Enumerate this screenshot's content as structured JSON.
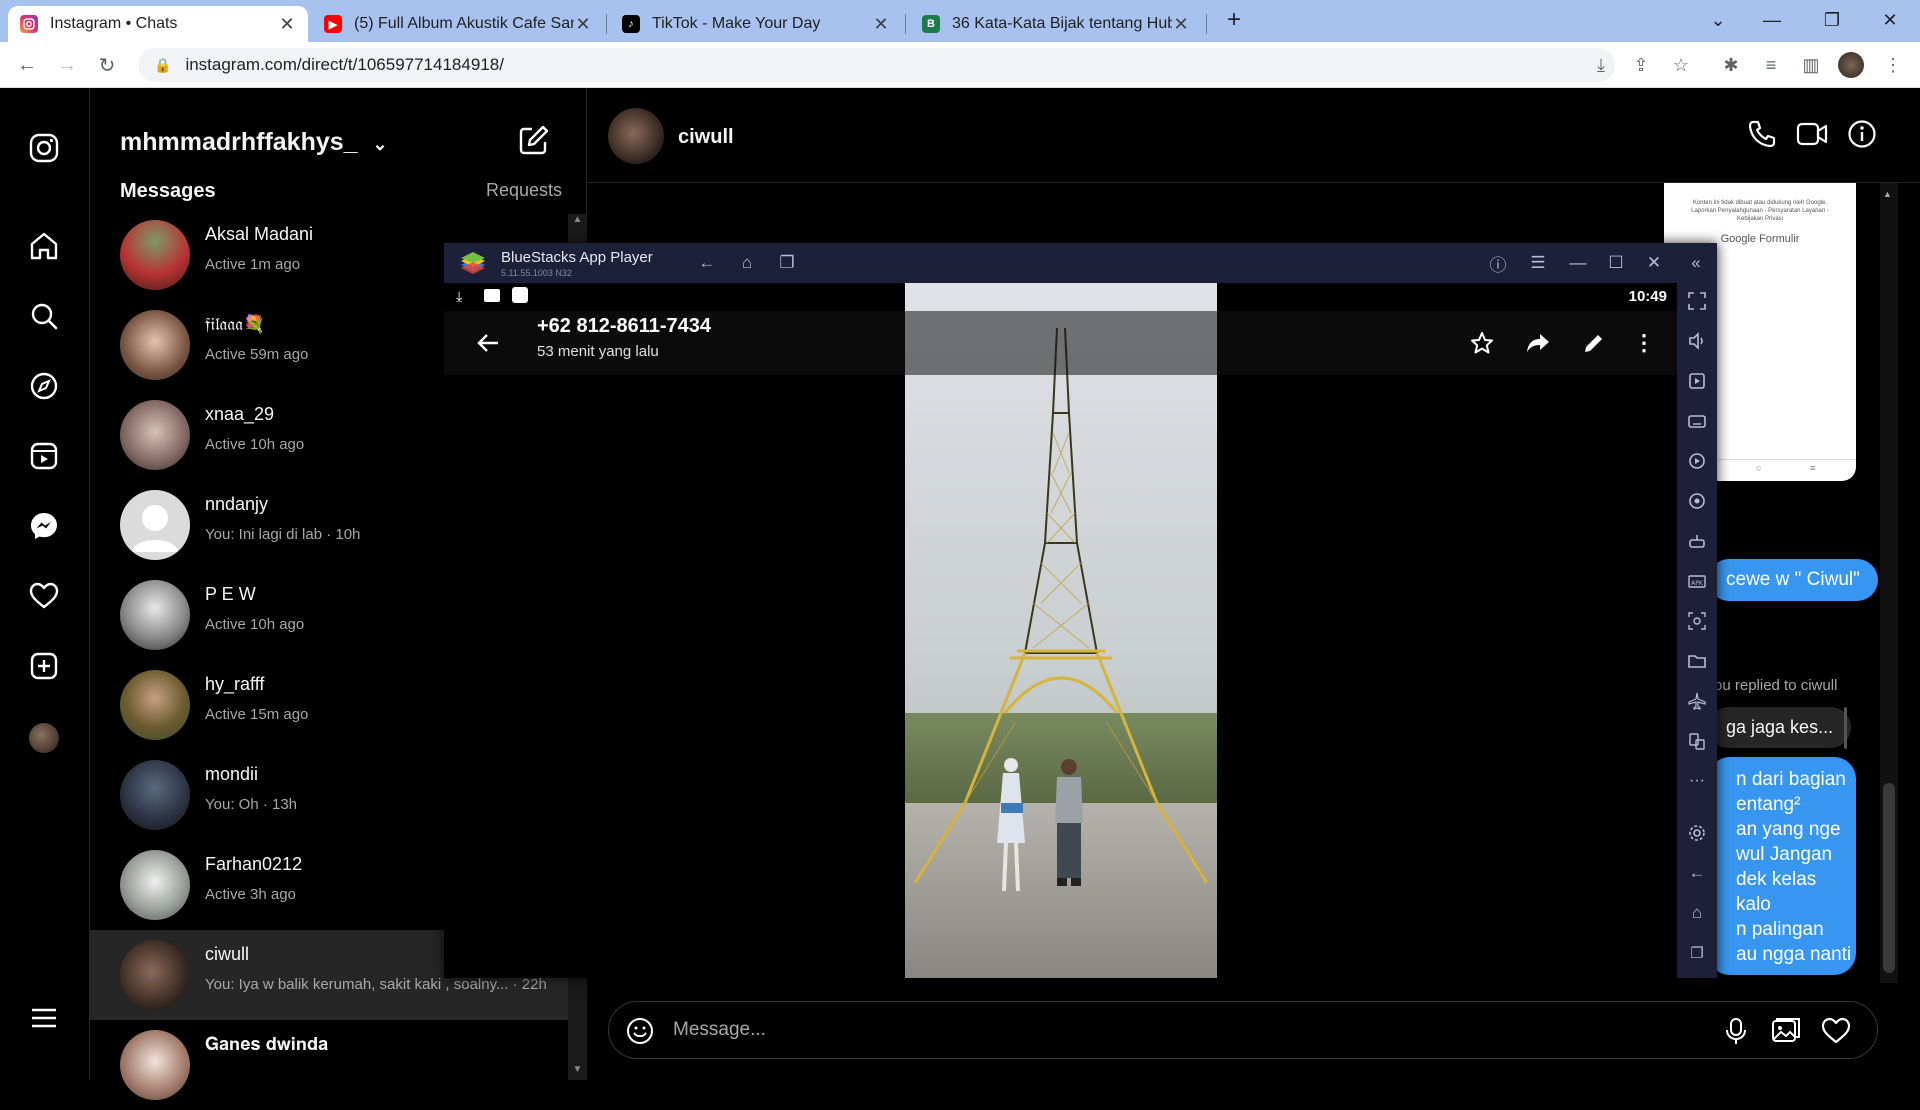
{
  "browser": {
    "tabs": [
      {
        "title": "Instagram • Chats",
        "icon": "instagram-icon",
        "color": "#e1306c"
      },
      {
        "title": "(5) Full Album Akustik Cafe Santa",
        "icon": "youtube-icon",
        "color": "#ff0000"
      },
      {
        "title": "TikTok - Make Your Day",
        "icon": "tiktok-icon",
        "color": "#000000"
      },
      {
        "title": "36 Kata-Kata Bijak tentang Hubu",
        "icon": "b-site-icon",
        "color": "#1d7a4a"
      }
    ],
    "url": "instagram.com/direct/t/106597714184918/"
  },
  "instagram": {
    "username": "mhmmadrhffakhys_",
    "messages_heading": "Messages",
    "requests_label": "Requests",
    "conversations": [
      {
        "name": "Aksal Madani",
        "status": "Active 1m ago"
      },
      {
        "name": "𝔣𝔦𝔩𝔞𝔞𝔞💐",
        "status": "Active 59m ago"
      },
      {
        "name": "xnaa_29",
        "status": "Active 10h ago"
      },
      {
        "name": "nndanjy",
        "status": "You: Ini lagi di lab · 10h"
      },
      {
        "name": "P E W",
        "status": "Active 10h ago"
      },
      {
        "name": "hy_rafff",
        "status": "Active 15m ago"
      },
      {
        "name": "mondii",
        "status": "You: Oh · 13h"
      },
      {
        "name": "Farhan0212",
        "status": "Active 3h ago"
      },
      {
        "name": "ciwull",
        "status": "You: Iya w balik kerumah, sakit kaki , soalny... · 22h"
      },
      {
        "name": "𝐆𝐚𝐧𝐞𝐬 𝐝𝐰𝐢𝐧𝐝𝐚",
        "status": ""
      }
    ],
    "chat": {
      "name": "ciwull",
      "shared_card": {
        "text": "Konten ini tidak dibuat atau didukung oleh Google. Laporkan Penyalahgunaan - Persyaratan Layanan - Kebijakan Privasi",
        "brand": "Google Formulir"
      },
      "bubble1": "cewe w \" Ciwul\"",
      "replied_note": "ou replied to ciwull",
      "reply_quote": "ga jaga kes...",
      "bubble2_lines": [
        "n dari bagian",
        "entang²",
        "an yang nge",
        "wul Jangan",
        "dek kelas kalo",
        "n palingan",
        "au ngga nanti"
      ],
      "composer_placeholder": "Message..."
    }
  },
  "bluestacks": {
    "app_name": "BlueStacks App Player",
    "version": "5.11.55.1003  N32",
    "clock": "10:49",
    "contact": "+62 812-8611-7434",
    "time_ago": "53 menit yang lalu"
  }
}
